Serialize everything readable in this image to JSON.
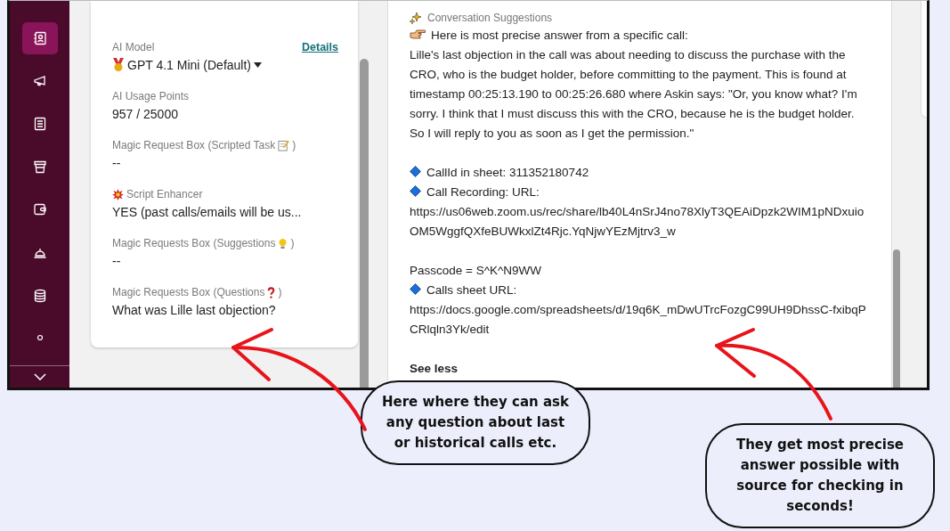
{
  "sidebar": {
    "items": [
      {
        "selected": true
      },
      {
        "selected": false
      },
      {
        "selected": false
      },
      {
        "selected": false
      },
      {
        "selected": false
      },
      {
        "selected": false
      },
      {
        "selected": false
      },
      {
        "selected": false
      }
    ]
  },
  "card": {
    "fields": [
      {
        "kind": "dropdown",
        "label": "AI Model",
        "link": "Details",
        "value": "GPT 4.1 Mini (Default)"
      },
      {
        "kind": "text",
        "label": "AI Usage Points",
        "value": "957 / 25000"
      },
      {
        "kind": "text",
        "label": "Magic Request Box (Scripted Task",
        "label_end": ")",
        "value": "--"
      },
      {
        "kind": "text",
        "label": "Script Enhancer",
        "value": "YES (past calls/emails will be us..."
      },
      {
        "kind": "text",
        "label": "Magic Requests Box (Suggestions",
        "label_end": ")",
        "value": "--"
      },
      {
        "kind": "text",
        "label": "Magic Requests Box (Questions",
        "label_end": ")",
        "value": "What was Lille last objection?"
      }
    ]
  },
  "answer": {
    "heading": "Conversation Suggestions",
    "sections": [
      [
        {
          "kind": "intro",
          "text": "Here is most precise answer from a specific call:"
        },
        {
          "kind": "text",
          "text": "Lille's last objection in the call was about needing to discuss the purchase with the CRO, who is the budget holder, before committing to the payment. This is found at timestamp 00:25:13.190 to 00:25:26.680 where Askin says: \"Or, you know what? I'm sorry. I think that I must discuss this with the CRO, because he is the budget holder. So I will reply to you as soon as I get the permission.\""
        }
      ],
      [
        {
          "kind": "bullet",
          "text": "CallId in sheet: 311352180742"
        },
        {
          "kind": "bullet",
          "text": "Call Recording: URL:"
        },
        {
          "kind": "url",
          "text": "https://us06web.zoom.us/rec/share/lb40L4nSrJ4no78XlyT3QEAiDpzk2WIM1pNDxuioOM5WggfQXfeBUWkxlZt4Rjc.YqNjwYEzMjtrv3_w"
        }
      ],
      [
        {
          "kind": "text",
          "text": "Passcode = S^K^N9WW"
        },
        {
          "kind": "bullet",
          "text": "Calls sheet URL:"
        },
        {
          "kind": "url",
          "text": "https://docs.google.com/spreadsheets/d/19q6K_mDwUTrcFozgC99UH9DhssC-fxibqPCRlqln3Yk/edit"
        }
      ]
    ],
    "toggle": "See less"
  },
  "callouts": [
    {
      "text": "Here where they can ask any question about last or historical calls etc."
    },
    {
      "text": "They get most precise answer possible with source for checking in seconds!"
    }
  ]
}
